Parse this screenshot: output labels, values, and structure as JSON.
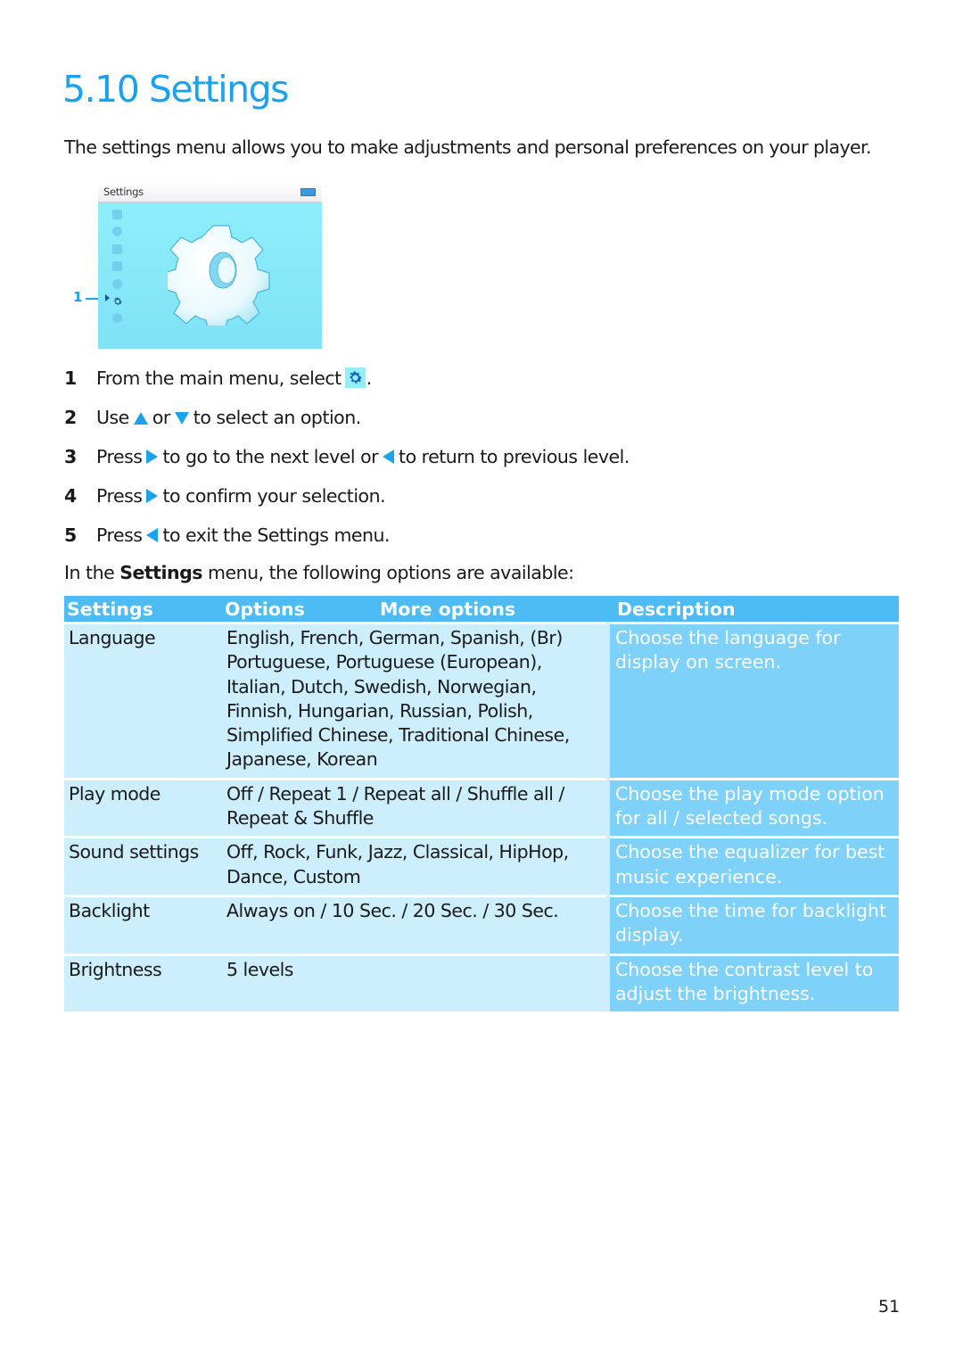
{
  "page": {
    "section_title": "5.10 Settings",
    "intro": "The settings menu allows you to make adjustments and personal preferences on your player.",
    "page_number": "51"
  },
  "device_screen": {
    "header_title": "Settings",
    "battery_icon": "battery-icon",
    "menu_icons": [
      "video-icon",
      "camera-icon",
      "music-icon",
      "radio-icon",
      "microphone-icon",
      "settings-gear-icon",
      "play-circle-icon"
    ],
    "selected_icon": "settings-gear-icon",
    "callout_label": "1",
    "accent": "#1aa3ec"
  },
  "steps": [
    {
      "num": "1",
      "parts": [
        "From the main menu, select",
        "."
      ],
      "icon": "settings-gear-icon"
    },
    {
      "num": "2",
      "parts": [
        "Use",
        "or",
        "to select an option."
      ],
      "icons": [
        "up-arrow-icon",
        "down-arrow-icon"
      ]
    },
    {
      "num": "3",
      "parts": [
        "Press",
        "to go to the next level or",
        "to return to previous level."
      ],
      "icons": [
        "right-arrow-icon",
        "left-arrow-icon"
      ]
    },
    {
      "num": "4",
      "parts": [
        "Press",
        "to confirm your selection."
      ],
      "icons": [
        "right-arrow-icon"
      ]
    },
    {
      "num": "5",
      "parts": [
        "Press",
        "to exit the Settings menu."
      ],
      "icons": [
        "left-arrow-icon"
      ]
    }
  ],
  "lead": {
    "before": "In the ",
    "bold": "Settings",
    "after": " menu, the following options are available:"
  },
  "table": {
    "headers": [
      "Settings",
      "Options",
      "More options",
      "Description"
    ],
    "rows": [
      {
        "setting": "Language",
        "options": [
          "English, French, German, Spanish, (Br)",
          "Portuguese, Portuguese (European),",
          "Italian, Dutch, Swedish, Norwegian,",
          "Finnish, Hungarian, Russian, Polish,",
          "Simplified Chinese, Traditional Chinese,",
          "Japanese, Korean"
        ],
        "description": [
          "Choose the language for",
          "display on screen."
        ]
      },
      {
        "setting": "Play mode",
        "options": [
          "Off / Repeat 1 / Repeat all / Shuffle all /",
          "Repeat & Shuffle"
        ],
        "description": [
          "Choose the play mode option",
          "for all / selected songs."
        ]
      },
      {
        "setting": "Sound settings",
        "options": [
          "Off, Rock, Funk, Jazz, Classical, HipHop,",
          "Dance, Custom"
        ],
        "description": [
          "Choose the equalizer for best",
          "music experience."
        ]
      },
      {
        "setting": "Backlight",
        "options": [
          "Always on / 10 Sec. / 20 Sec. / 30 Sec."
        ],
        "description": [
          "Choose the time for backlight",
          "display."
        ]
      },
      {
        "setting": "Brightness",
        "options": [
          "5 levels"
        ],
        "description": [
          "Choose the contrast level to",
          "adjust the brightness."
        ]
      }
    ]
  },
  "colors": {
    "title": "#1aa3ec",
    "table_header_bg": "#4dbcf5",
    "table_cell_bg": "#cdeefc",
    "description_bg": "#7ed2fa"
  }
}
